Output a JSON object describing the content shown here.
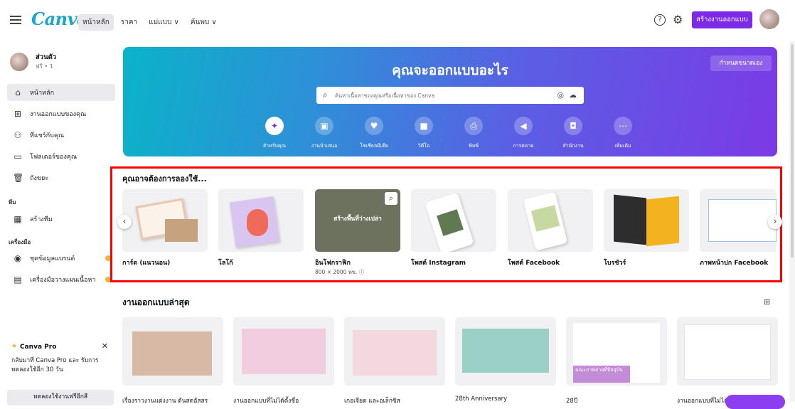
{
  "topbar": {
    "logo": "Canva",
    "nav": [
      "หน้าหลัก",
      "ราคา",
      "แม่แบบ ∨",
      "ค้นพบ ∨"
    ],
    "create_button": "สร้างงานออกแบบ"
  },
  "sidebar": {
    "profile_name": "ส่วนตัว",
    "profile_sub": "ฟรี • 1",
    "items": [
      {
        "label": "หน้าหลัก",
        "icon": "home-icon"
      },
      {
        "label": "งานออกแบบของคุณ",
        "icon": "grid-icon"
      },
      {
        "label": "ที่แชร์กับคุณ",
        "icon": "people-icon"
      },
      {
        "label": "โฟลเดอร์ของคุณ",
        "icon": "folder-icon"
      },
      {
        "label": "ถังขยะ",
        "icon": "trash-icon"
      }
    ],
    "team_label": "ทีม",
    "team_items": [
      {
        "label": "สร้างทีม",
        "icon": "team-icon"
      }
    ],
    "tools_label": "เครื่องมือ",
    "tools_items": [
      {
        "label": "ชุดข้อมูลแบรนด์",
        "icon": "brand-icon"
      },
      {
        "label": "เครื่องมือวางแผนเนื้อหา",
        "icon": "calendar-icon"
      }
    ],
    "pro_title": "Canva Pro",
    "pro_desc": "กลับมาที่ Canva Pro และ รับการทดลองใช้อีก 30 วัน",
    "trial_button": "ทดลองใช้งานฟรีอีกสี"
  },
  "hero": {
    "title": "คุณจะออกแบบอะไร",
    "custom_size": "กำหนดขนาดเอง",
    "search_placeholder": "ค้นหาเนื้อหาของคุณหรือเนื้อหาของ Canva",
    "categories": [
      {
        "label": "สำหรับคุณ",
        "icon": "sparkle-icon"
      },
      {
        "label": "งานนำเสนอ",
        "icon": "presentation-icon"
      },
      {
        "label": "โซเชียลมีเดีย",
        "icon": "heart-chat-icon"
      },
      {
        "label": "วิดีโอ",
        "icon": "video-icon"
      },
      {
        "label": "พิมพ์",
        "icon": "printer-icon"
      },
      {
        "label": "การตลาด",
        "icon": "megaphone-icon"
      },
      {
        "label": "สำนักงาน",
        "icon": "briefcase-icon"
      },
      {
        "label": "เพิ่มเติม",
        "icon": "more-icon"
      }
    ]
  },
  "suggest": {
    "title": "คุณอาจต้องการลองใช้...",
    "overlay_text": "สร้างพื้นที่ว่างเปล่า",
    "items": [
      {
        "label": "การ์ด (แนวนอน)",
        "sub": ""
      },
      {
        "label": "โลโก้",
        "sub": ""
      },
      {
        "label": "อินโฟกราฟิก",
        "sub": "800 × 2000 พข."
      },
      {
        "label": "โพสต์ Instagram",
        "sub": ""
      },
      {
        "label": "โพสต์ Facebook",
        "sub": ""
      },
      {
        "label": "โบรชัวร์",
        "sub": ""
      },
      {
        "label": "ภาพหน้าปก Facebook",
        "sub": ""
      }
    ]
  },
  "recent": {
    "title": "งานออกแบบล่าสุด",
    "items": [
      {
        "label": "เรื่องราวงานแต่งงาน ดันสดอัสสร"
      },
      {
        "label": "งานออกแบบที่ไม่ได้ตั้งชื่อ"
      },
      {
        "label": "เกอเจียด และอเล็กซิส"
      },
      {
        "label": "28th Anniversary"
      },
      {
        "label": "28ปี"
      },
      {
        "label": "งานออกแบบที่ไม่ได้ตั้งชื่อ"
      }
    ],
    "card_five_caption": "คณะภาพถ่ายที่ปัจจุบัน"
  },
  "colors": {
    "accent": "#7d2ae8",
    "highlight": "#ff0000"
  }
}
